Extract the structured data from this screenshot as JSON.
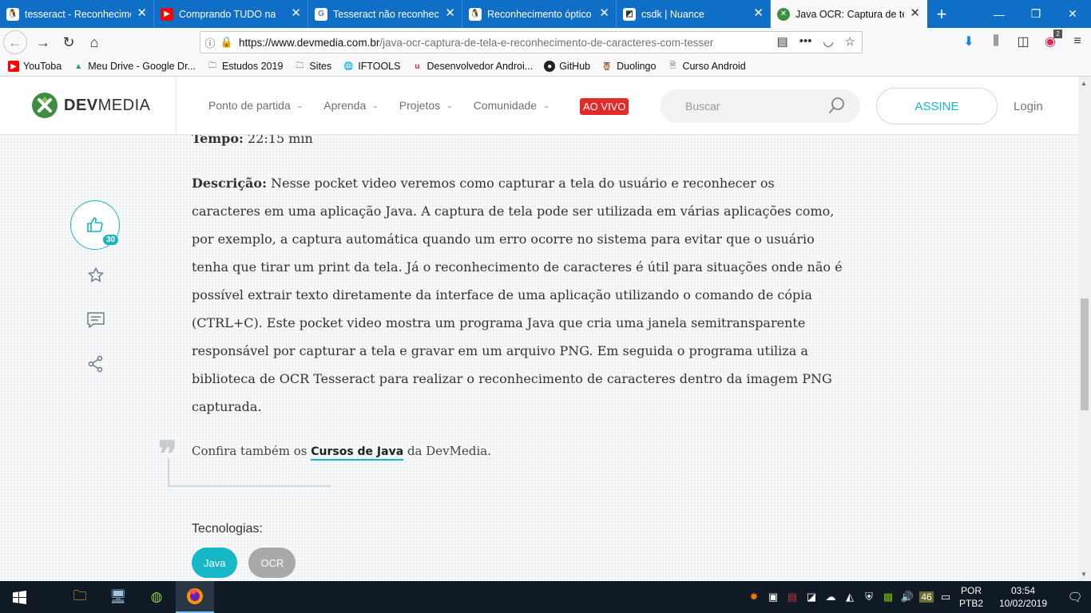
{
  "browser": {
    "tabs": [
      {
        "title": "tesseract - Reconhecimer",
        "icon": "penguin-icon",
        "active": false
      },
      {
        "title": "Comprando TUDO na",
        "icon": "youtube-icon",
        "active": false
      },
      {
        "title": "Tesseract não reconhece",
        "icon": "google-icon",
        "active": false
      },
      {
        "title": "Reconhecimento óptico",
        "icon": "penguin-icon",
        "active": false
      },
      {
        "title": "csdk | Nuance",
        "icon": "nuance-icon",
        "active": false
      },
      {
        "title": "Java OCR: Captura de tel",
        "icon": "devmedia-icon",
        "active": true
      }
    ],
    "url_host": "https://www.devmedia.com.br",
    "url_path": "/java-ocr-captura-de-tela-e-reconhecimento-de-caracteres-com-tesser",
    "library_badge": "2",
    "bookmarks": [
      {
        "label": "YouToba",
        "icon": "youtube-icon"
      },
      {
        "label": "Meu Drive - Google Dr...",
        "icon": "drive-icon"
      },
      {
        "label": "Estudos 2019",
        "icon": "folder-icon"
      },
      {
        "label": "Sites",
        "icon": "folder-icon"
      },
      {
        "label": "IFTOOLS",
        "icon": "globe-icon"
      },
      {
        "label": "Desenvolvedor Androi...",
        "icon": "u-icon"
      },
      {
        "label": "GitHub",
        "icon": "github-icon"
      },
      {
        "label": "Duolingo",
        "icon": "duolingo-icon"
      },
      {
        "label": "Curso Android",
        "icon": "page-icon"
      }
    ]
  },
  "site": {
    "logo_bold": "DEV",
    "logo_rest": "MEDIA",
    "menu": [
      "Ponto de partida",
      "Aprenda",
      "Projetos",
      "Comunidade"
    ],
    "live_label": "AO VIVO",
    "search_placeholder": "Buscar",
    "subscribe_label": "ASSINE",
    "login_label": "Login"
  },
  "sidebar": {
    "likes": "30"
  },
  "article": {
    "tempo_label": "Tempo:",
    "tempo_value": "22:15 min",
    "desc_label": "Descrição:",
    "desc_text": "Nesse pocket video veremos como capturar a tela do usuário e reconhecer os caracteres em uma aplicação Java. A captura de tela pode ser utilizada em várias aplicações como, por exemplo, a captura automática quando um erro ocorre no sistema para evitar que o usuário tenha que tirar um print da tela. Já o reconhecimento de caracteres é útil para situações onde não é possível extrair texto diretamente da interface de uma aplicação utilizando o comando de cópia (CTRL+C). Este pocket video mostra um programa Java que cria uma janela semitransparente responsável por capturar a tela e gravar em um arquivo PNG. Em seguida o programa utiliza a biblioteca de OCR Tesseract para realizar o reconhecimento de caracteres dentro da imagem PNG capturada.",
    "quote_before": "Confira também os",
    "quote_link": "Cursos de Java",
    "quote_after": "da DevMedia.",
    "tech_label": "Tecnologias:",
    "tags": [
      {
        "label": "Java",
        "color": "#16b8c8"
      },
      {
        "label": "OCR",
        "color": "#a9a9a9"
      }
    ]
  },
  "taskbar": {
    "battery": "46",
    "lang1": "POR",
    "lang2": "PTB2",
    "time": "03:54",
    "date": "10/02/2019"
  }
}
